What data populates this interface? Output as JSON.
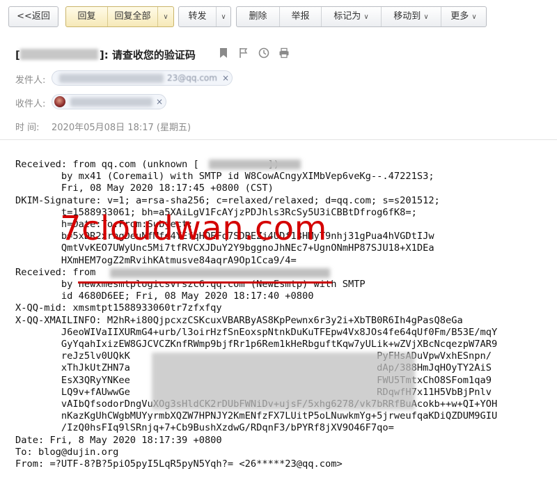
{
  "toolbar": {
    "back": "<<返回",
    "reply": "回复",
    "reply_all": "回复全部",
    "forward": "转发",
    "delete": "删除",
    "report": "举报",
    "mark_as": "标记为",
    "move_to": "移动到",
    "more": "更多",
    "caret": "∨"
  },
  "mail": {
    "subject": "]: 请查收您的验证码",
    "sender_label": "发件人:",
    "sender_suffix": "23@qq.com",
    "recipient_label": "收件人:",
    "time_label": "时 间:",
    "time_value": "2020年05月08日 18:17 (星期五)"
  },
  "headers_text": [
    "Received: from qq.com (unknown [            ])",
    "        by mx41 (Coremail) with SMTP id W8CowACngyXIMbVep6veKg--.47221S3;",
    "        Fri, 08 May 2020 18:17:45 +0800 (CST)",
    "DKIM-Signature: v=1; a=rsa-sha256; c=relaxed/relaxed; d=qq.com; s=s201512;",
    "        t=1588933061; bh=a5XAiLgV1FcAYjzPDJhls3RcSy5U3iCBBtDfrog6fK8=;",
    "        h=Date:To:From:Subject;",
    "        b=5xDR2xrhgDeuNfMfd4YEfqHQEFq7SDBEZj4UDf13HMyT9nhj31gPua4hVGDtIJw",
    "        QmtVvKEO7UWyUnc5Mi7tfRVCXJDuY2Y9bggnoJhNEc7+UgnONmHP87SJU18+X1DEa",
    "        HXmHEM7ogZ2mRvihKAtmusve84aqrA9Op1Cca9/4=",
    "Received: from                               ",
    "        by newxmesmtplogicsvrszc6.qq.com (NewEsmtp) with SMTP",
    "        id 4680D6EE; Fri, 08 May 2020 18:17:40 +0800",
    "X-QQ-mid: xmsmtpt1588933060tr7zfxfqy",
    "X-QQ-XMAILINFO: M2hR+i80QjpcxzCSKcuxVBARByAS8KpPewnx6r3y2i+XbTB0R6Ih4gPasQ8eGa",
    "        J6eoWIVaIIXURmG4+urb/l3oirHzfSnEoxspNtnkDuKuTFEpw4Vx8JOs4fe64qUf0Fm/B53E/mqY",
    "        GyYqahIxizEW8GJCVCZKnfRWmp9bjfRr1p6Rem1kHeRbguftKqw7yULik+wZVjXBcNcqezpW7AR9",
    "        reJz5lv0UQkK                                           PyFHsADuVpwVxhESnpn/",
    "        xThJkUtZHN7a                                           dAp/388HmJqHOyTY2AiS",
    "        EsX3QRyYNKee                                           FWU5TmtxChO8SFom1qa9",
    "        LQ9v+fAUwwGe                                           RDqwfH7x11H5VbBjPnlv",
    "        vAIbQfsodorDngVuXOg3sHldCK2rDUbFWNiDv+ujsF/5xhg6278/vk7bRRfBuAcokb++w+QI+YOH",
    "        nKazKgUhCWgbMUYyrmbXQZW7HPNJY2KmENfzFX7LUitP5oLNuwkmYg+5jrweufqaKDiQZDUM9GIU",
    "        /IzQ0hsFIq9lSRnjq+7+Cb9BushXzdwG/RDqnF3/bPYRf8jXV9O46F7qo=",
    "Date: Fri, 8 May 2020 18:17:39 +0800",
    "To: blog@dujin.org",
    "From: =?UTF-8?B?5piO5pyI5LqR5pyN5Yqh?= <26*****23@qq.com>"
  ],
  "watermark": "7cloudwan.com",
  "icons": [
    "bookmark-icon",
    "flag-icon",
    "clock-icon",
    "print-icon",
    "clear-icon"
  ]
}
